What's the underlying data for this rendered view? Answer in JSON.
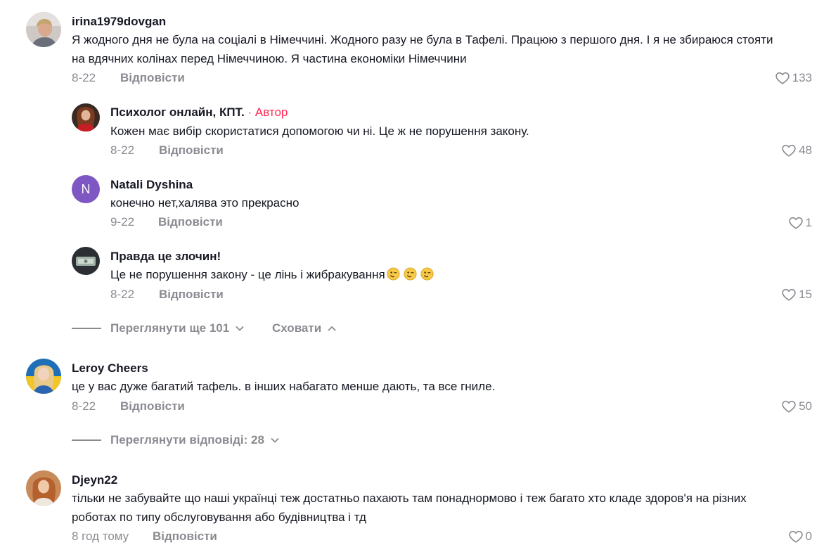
{
  "comments": [
    {
      "username": "irina1979dovgan",
      "text_lines": [
        "Я жодного дня не була на соціалі в Німеччині. Жодного разу не була в Тафелі. Працюю з першого дня. І я не збираюся стояти",
        "на вдячних колінах перед Німеччиною. Я частина економіки Німеччини"
      ],
      "date": "8-22",
      "reply_label": "Відповісти",
      "likes": "133",
      "replies": [
        {
          "username": "Психолог онлайн, КПТ.",
          "author_tag": " · Автор",
          "text": "Кожен має вибір скористатися допомогою чи ні. Це ж не порушення закону.",
          "date": "8-22",
          "reply_label": "Відповісти",
          "likes": "48"
        },
        {
          "username": "Natali Dyshina",
          "avatar_letter": "N",
          "text": "конечно нет,халява это прекрасно",
          "date": "9-22",
          "reply_label": "Відповісти",
          "likes": "1"
        },
        {
          "username": "Правда це злочин!",
          "text": "Це не порушення закону - це лінь і жибракування",
          "emoji": [
            "winking-face",
            "winking-face",
            "winking-face"
          ],
          "date": "8-22",
          "reply_label": "Відповісти",
          "likes": "15"
        }
      ],
      "view_more": "Переглянути ще 101",
      "hide": "Сховати"
    },
    {
      "username": "Leroy Cheers",
      "text_lines": [
        "це у вас дуже багатий тафель. в інших набагато менше дають, та все гниле."
      ],
      "date": "8-22",
      "reply_label": "Відповісти",
      "likes": "50",
      "view_replies": "Переглянути відповіді: 28"
    },
    {
      "username": "Djeyn22",
      "text_lines": [
        "тільки не забувайте що наші українці теж достатньо пахають там понаднормово і теж багато хто кладе здоров'я на різних",
        "роботах по типу обслуговування або будівництва і тд"
      ],
      "date": "8 год тому",
      "reply_label": "Відповісти",
      "likes": "0"
    }
  ],
  "colors": {
    "text": "#161823",
    "secondary": "#8a8b91",
    "author": "#fe2c55",
    "avatar_n": "#7e57c2"
  }
}
